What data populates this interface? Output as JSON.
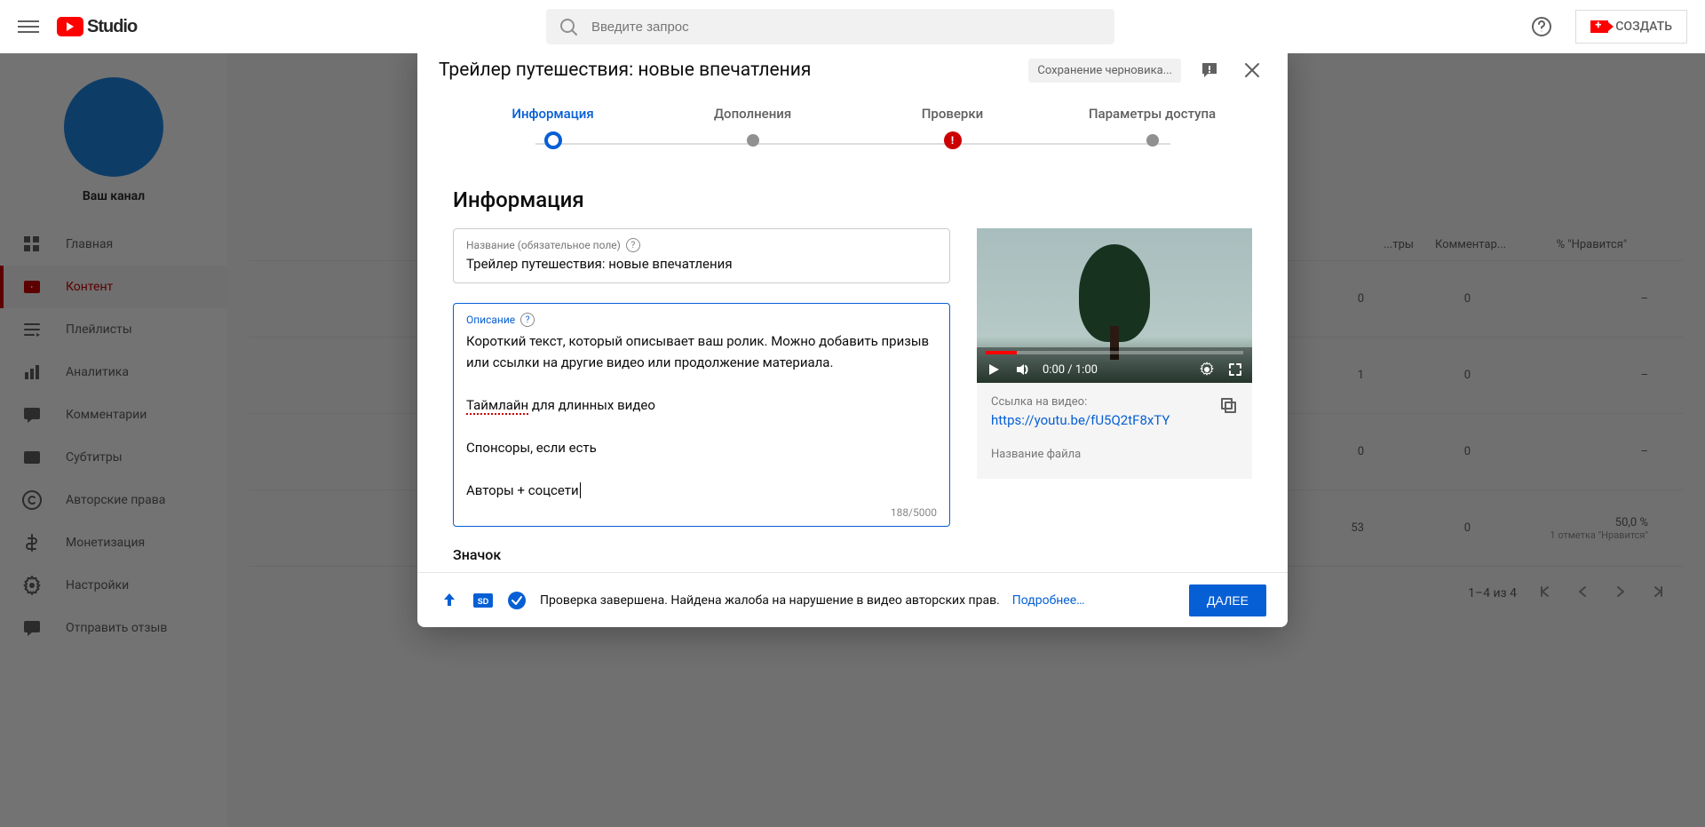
{
  "header": {
    "logo_text": "Studio",
    "search_placeholder": "Введите запрос",
    "create_label": "СОЗДАТЬ"
  },
  "sidebar": {
    "channel_title": "Ваш канал",
    "items": [
      {
        "label": "Главная",
        "icon": "dashboard"
      },
      {
        "label": "Контент",
        "icon": "content",
        "active": true
      },
      {
        "label": "Плейлисты",
        "icon": "playlist"
      },
      {
        "label": "Аналитика",
        "icon": "analytics"
      },
      {
        "label": "Комментарии",
        "icon": "comments"
      },
      {
        "label": "Субтитры",
        "icon": "subtitles"
      },
      {
        "label": "Авторские права",
        "icon": "copyright"
      },
      {
        "label": "Монетизация",
        "icon": "money"
      },
      {
        "label": "Настройки",
        "icon": "settings"
      },
      {
        "label": "Отправить отзыв",
        "icon": "feedback"
      }
    ]
  },
  "table": {
    "headers": {
      "views": "...тры",
      "comments": "Комментар...",
      "likes": "% \"Нравится\""
    },
    "rows": [
      {
        "views": "0",
        "comments": "0",
        "likes": "–"
      },
      {
        "views": "1",
        "comments": "0",
        "likes": "–"
      },
      {
        "views": "0",
        "comments": "0",
        "likes": "–"
      },
      {
        "views": "53",
        "comments": "0",
        "likes": "50,0 %",
        "likes_sub": "1 отметка \"Нравится\""
      }
    ],
    "pagination": "1–4 из 4"
  },
  "modal": {
    "title": "Трейлер путешествия: новые впечатления",
    "saving_chip": "Сохранение черновика...",
    "steps": [
      "Информация",
      "Дополнения",
      "Проверки",
      "Параметры доступа"
    ],
    "section_title": "Информация",
    "title_label": "Название (обязательное поле)",
    "title_value": "Трейлер путешествия: новые впечатления",
    "desc_label": "Описание",
    "desc_lines": [
      "Короткий текст, который описывает ваш ролик. Можно добавить призыв или ссылки на другие видео или продолжение материала.",
      "",
      "",
      "",
      "Спонсоры, если есть",
      "",
      "Авторы + соцсети"
    ],
    "timeline_word": "Таймлайн",
    "timeline_rest": " для длинных видео",
    "char_count": "188/5000",
    "thumb_section": "Значок",
    "video_time": "0:00 / 1:00",
    "link_label": "Ссылка на видео:",
    "link_url": "https://youtu.be/fU5Q2tF8xTY",
    "file_label": "Название файла",
    "footer_status": "Проверка завершена. Найдена жалоба на нарушение в видео авторских прав.",
    "footer_more": "Подробнее…",
    "next_button": "ДАЛЕЕ"
  }
}
